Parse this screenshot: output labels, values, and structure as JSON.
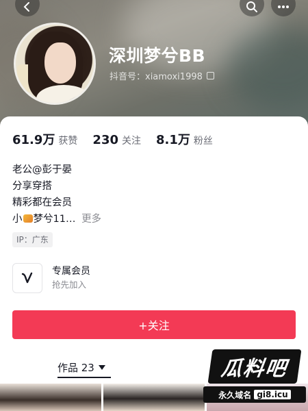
{
  "profile": {
    "name": "深圳梦兮BB",
    "account_label": "抖音号：xiamoxi1998"
  },
  "stats": [
    {
      "value": "61.9万",
      "label": "获赞"
    },
    {
      "value": "230",
      "label": "关注"
    },
    {
      "value": "8.1万",
      "label": "粉丝"
    }
  ],
  "bio": {
    "line1": "老公@彭于晏",
    "line2": "分享穿搭",
    "line3": "精彩都在会员",
    "line4_prefix": "小",
    "line4_rest": "梦兮11…",
    "more": "更多"
  },
  "ip_tag": "IP：广东",
  "member": {
    "title": "专属会员",
    "subtitle": "抢先加入"
  },
  "follow_button": "+关注",
  "works_tab": "作品 23",
  "watermark": {
    "logo": "瓜料吧",
    "tagline": "永久域名",
    "domain": "gi8.icu"
  },
  "colors": {
    "accent": "#f33a55",
    "text_primary": "#161823",
    "text_secondary": "#6b6d76"
  }
}
